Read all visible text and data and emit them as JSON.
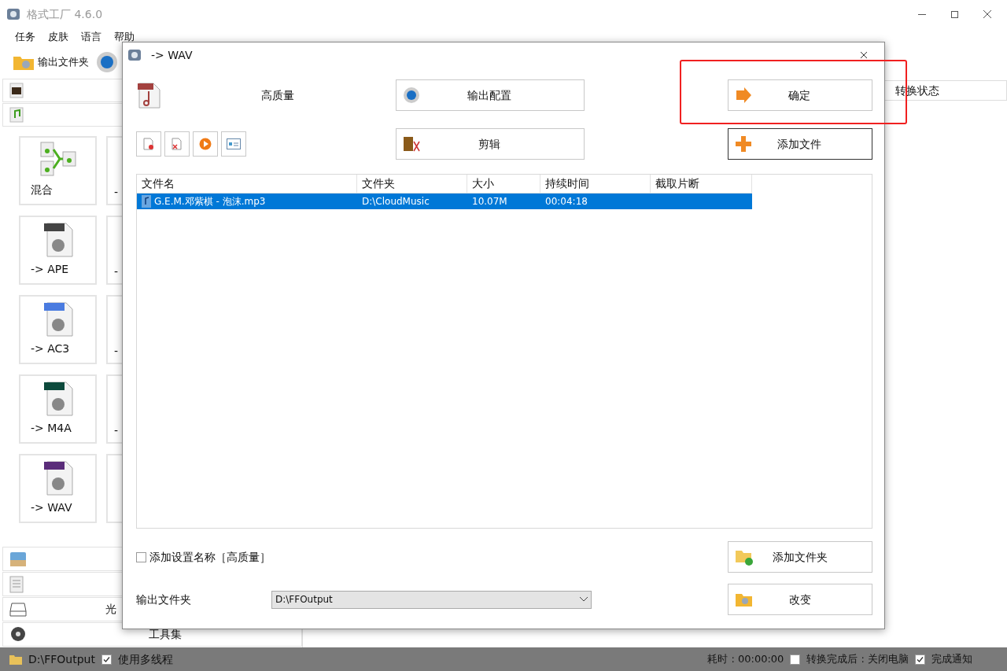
{
  "main_window": {
    "title": "格式工厂 4.6.0",
    "menu": [
      "任务",
      "皮肤",
      "语言",
      "帮助"
    ],
    "toolbar": [
      {
        "label": "输出文件夹"
      }
    ]
  },
  "tiles": [
    {
      "kind": "mix",
      "label": "混合"
    },
    {
      "kind": "ape",
      "label": "-> APE"
    },
    {
      "kind": "aac",
      "label": "-> AC3"
    },
    {
      "kind": "m4a",
      "label": "-> M4A"
    },
    {
      "kind": "wav",
      "label": "-> WAV"
    }
  ],
  "tiles_column_2": [
    "-",
    "-",
    "-",
    "-"
  ],
  "categories_bottom": [
    {
      "kind": "picture"
    },
    {
      "kind": "document"
    },
    {
      "kind": "disc",
      "label": "光"
    },
    {
      "kind": "tools",
      "label": "工具集"
    }
  ],
  "status_panel": {
    "header": "转换状态"
  },
  "dialog": {
    "title": "-> WAV",
    "quality": "高质量",
    "buttons": {
      "output_config": "输出配置",
      "ok": "确定",
      "clip": "剪辑",
      "add_file": "添加文件",
      "add_folder": "添加文件夹",
      "change": "改变"
    },
    "columns": [
      "文件名",
      "文件夹",
      "大小",
      "持续时间",
      "截取片断"
    ],
    "rows": [
      {
        "cells": [
          "G.E.M.邓紫棋 - 泡沫.mp3",
          "D:\\CloudMusic",
          "10.07M",
          "00:04:18"
        ],
        "selected": true
      }
    ],
    "add_setting_name": {
      "label": "添加设置名称［高质量］",
      "checked": false
    },
    "output_folder": {
      "label": "输出文件夹",
      "value": "D:\\FFOutput"
    }
  },
  "status_bar": {
    "folder": "D:\\FFOutput",
    "multithread": {
      "label": "使用多线程",
      "checked": true
    },
    "elapsed": "耗时 : 00:00:00",
    "shutdown": {
      "label": "转换完成后 : 关闭电脑",
      "checked": false
    },
    "notify": {
      "label": "完成通知",
      "checked": true
    }
  }
}
